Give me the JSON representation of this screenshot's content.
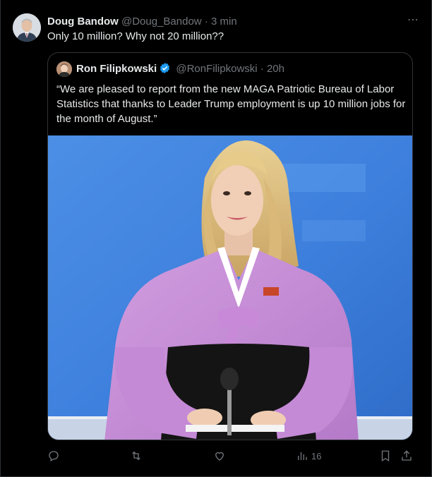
{
  "author": {
    "name": "Doug Bandow",
    "handle": "@Doug_Bandow",
    "separator": "·",
    "time": "3 min"
  },
  "tweet": {
    "text": "Only 10 million? Why not 20 million??"
  },
  "quoted": {
    "name": "Ron Filipkowski",
    "handle": "@RonFilipkowski",
    "separator": "·",
    "time": "20h",
    "text": "“We are pleased to report from the new MAGA Patriotic Bureau of Labor Statistics that thanks to Leader Trump employment is up 10 million jobs for the month of August.”"
  },
  "more_icon": "⋯",
  "actions": {
    "reply_icon": "reply-icon",
    "retweet_icon": "retweet-icon",
    "like_icon": "heart-icon",
    "views_icon": "analytics-icon",
    "views_count": "16",
    "bookmark_icon": "bookmark-icon",
    "share_icon": "share-icon"
  },
  "colors": {
    "background": "#000000",
    "text": "#e7e9ea",
    "muted": "#71767b",
    "border": "#2f3336",
    "verified": "#1d9bf0",
    "robe": "#c48ad6"
  }
}
